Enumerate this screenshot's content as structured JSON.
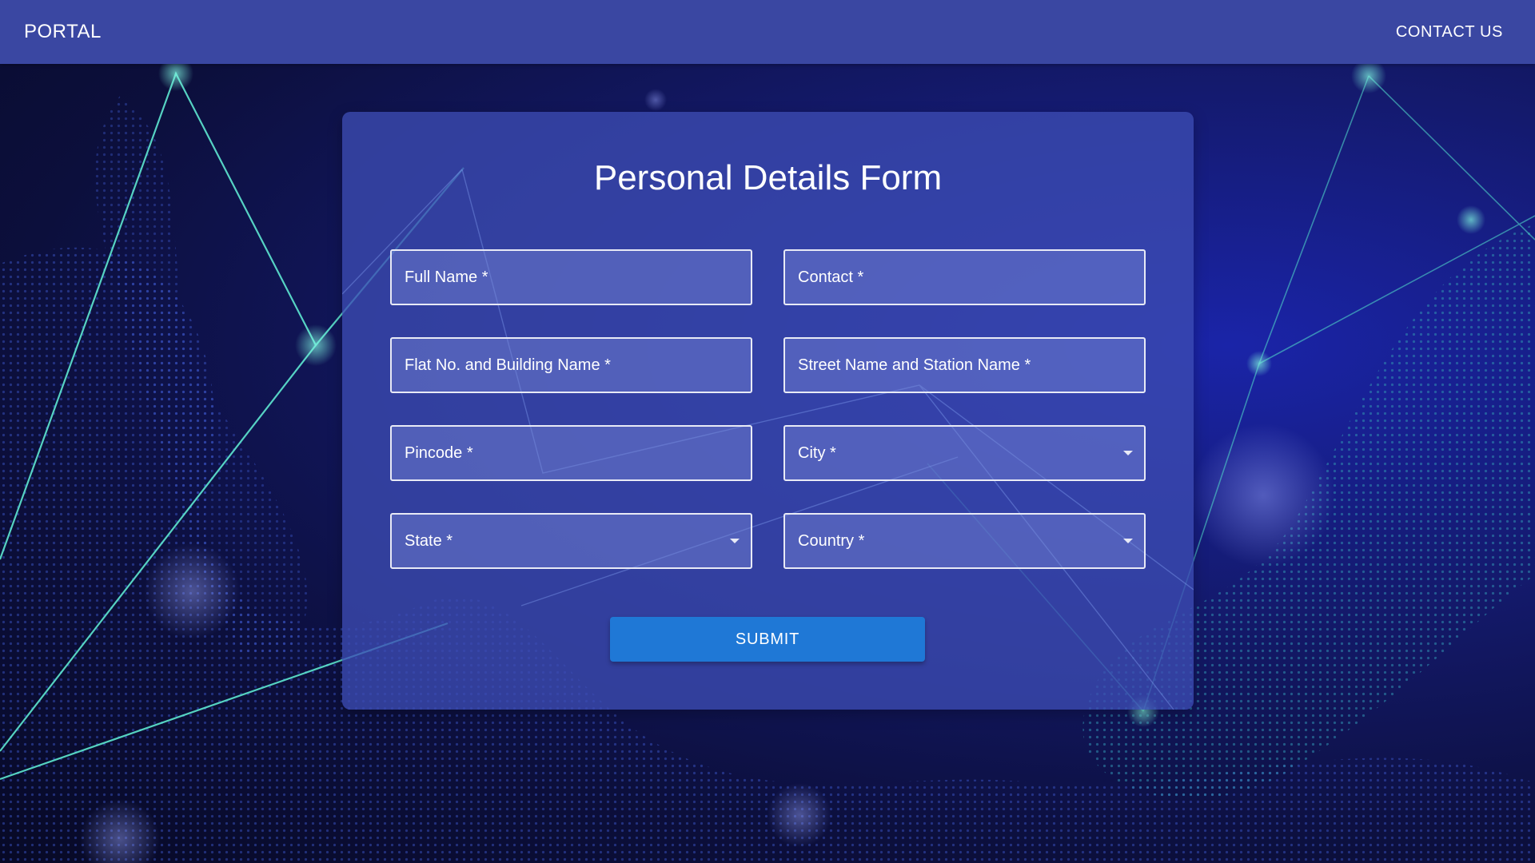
{
  "header": {
    "brand": "PORTAL",
    "contact_link": "CONTACT US"
  },
  "form": {
    "title": "Personal Details Form",
    "fields": {
      "full_name": "Full Name *",
      "contact": "Contact *",
      "flat_building": "Flat No. and Building Name *",
      "street_station": "Street Name and Station Name *",
      "pincode": "Pincode *",
      "city": "City *",
      "state": "State *",
      "country": "Country *"
    },
    "submit_label": "SUBMIT"
  },
  "colors": {
    "appbar": "#3a47a2",
    "card": "#3c4cb2",
    "submit_button": "#1f78d6",
    "accent_lines": "#5ee8d0",
    "background_dark": "#0c0f3c"
  }
}
